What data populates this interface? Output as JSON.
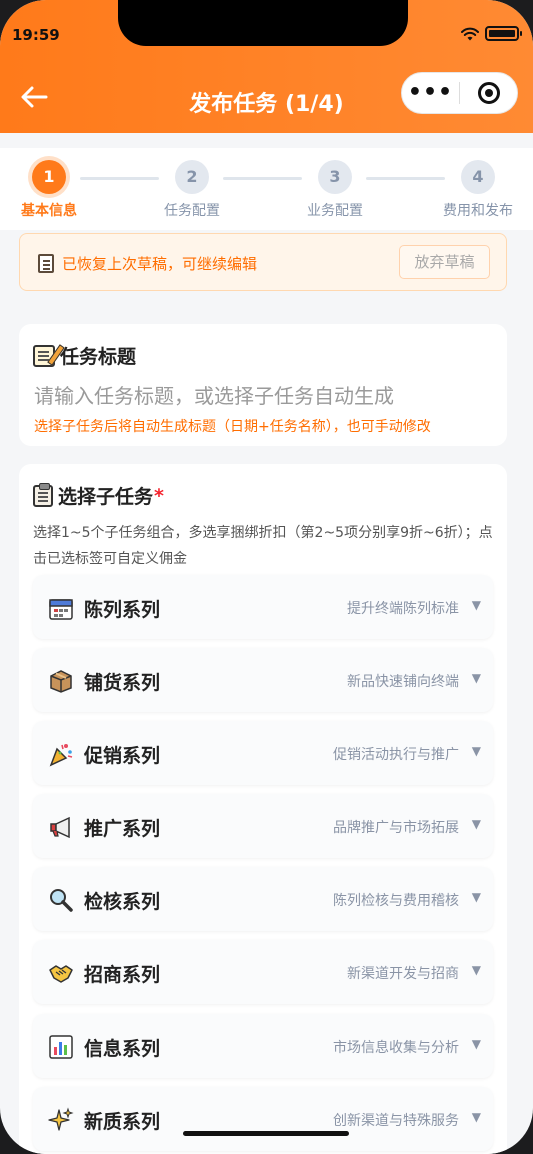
{
  "status": {
    "time": "19:59"
  },
  "header": {
    "title": "发布任务 (1/4)",
    "capsule_more": "•••"
  },
  "steps": [
    {
      "num": "1",
      "label": "基本信息",
      "active": true
    },
    {
      "num": "2",
      "label": "任务配置",
      "active": false
    },
    {
      "num": "3",
      "label": "业务配置",
      "active": false
    },
    {
      "num": "4",
      "label": "费用和发布",
      "active": false
    }
  ],
  "draft": {
    "text": "已恢复上次草稿，可继续编辑",
    "button": "放弃草稿"
  },
  "task_title": {
    "label": "任务标题",
    "placeholder": "请输入任务标题，或选择子任务自动生成",
    "hint": "选择子任务后将自动生成标题（日期+任务名称），也可手动修改"
  },
  "subtasks": {
    "label": "选择子任务",
    "required_mark": "*",
    "desc": "选择1~5个子任务组合，多选享捆绑折扣（第2~5项分别享9折~6折）；点击已选标签可自定义佣金",
    "items": [
      {
        "name": "陈列系列",
        "desc": "提升终端陈列标准",
        "icon": "calendar-icon"
      },
      {
        "name": "铺货系列",
        "desc": "新品快速铺向终端",
        "icon": "package-icon"
      },
      {
        "name": "促销系列",
        "desc": "促销活动执行与推广",
        "icon": "party-popper-icon"
      },
      {
        "name": "推广系列",
        "desc": "品牌推广与市场拓展",
        "icon": "megaphone-icon"
      },
      {
        "name": "检核系列",
        "desc": "陈列检核与费用稽核",
        "icon": "magnifier-icon"
      },
      {
        "name": "招商系列",
        "desc": "新渠道开发与招商",
        "icon": "handshake-icon"
      },
      {
        "name": "信息系列",
        "desc": "市场信息收集与分析",
        "icon": "bar-chart-icon"
      },
      {
        "name": "新质系列",
        "desc": "创新渠道与特殊服务",
        "icon": "sparkles-icon"
      }
    ]
  },
  "colors": {
    "accent": "#ff7a1a",
    "hint": "#ff6d00",
    "required": "#f5222d"
  }
}
